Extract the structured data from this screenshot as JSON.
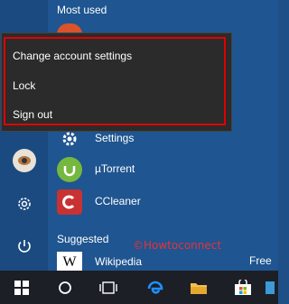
{
  "start_menu": {
    "most_used_label": "Most used",
    "suggested_label": "Suggested",
    "apps": [
      {
        "label": "Settings",
        "icon": "gear-icon"
      },
      {
        "label": "µTorrent",
        "icon": "utorrent-icon"
      },
      {
        "label": "CCleaner",
        "icon": "ccleaner-icon"
      }
    ],
    "suggested": {
      "label": "Wikipedia",
      "badge": "Free",
      "icon_text": "W"
    }
  },
  "account_menu": {
    "items": [
      "Change account settings",
      "Lock",
      "Sign out"
    ]
  },
  "watermark": "©Howtoconnect",
  "colors": {
    "accent": "#1f5590",
    "highlight": "#e00000",
    "taskbar": "#1c1f26",
    "utorrent": "#76b83f",
    "edge": "#1e90ff"
  }
}
